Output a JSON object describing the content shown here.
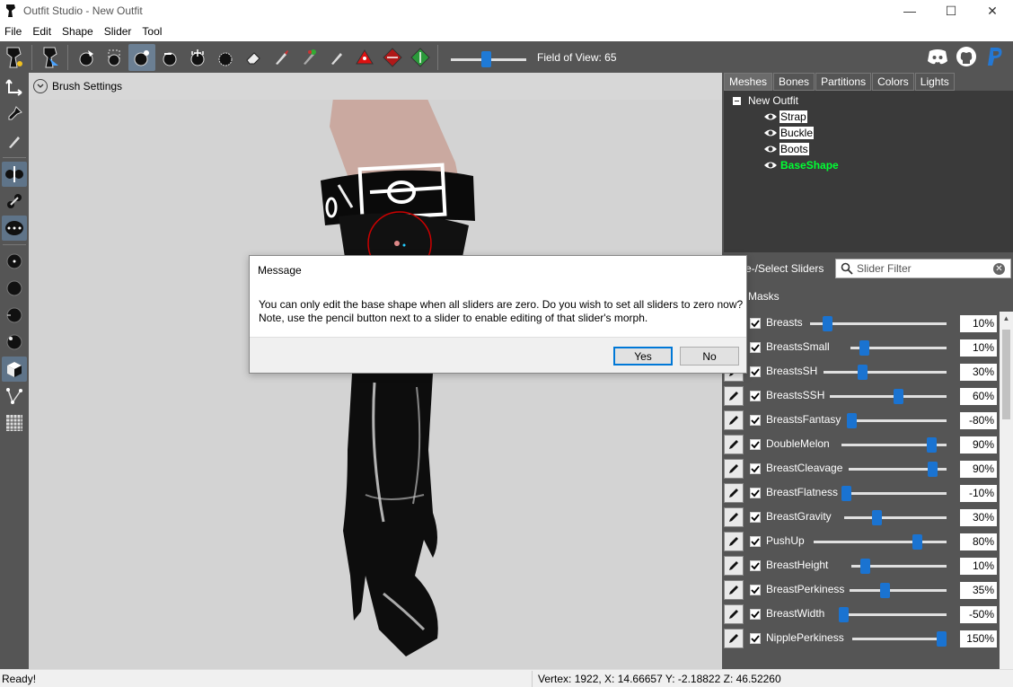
{
  "window": {
    "title": "Outfit Studio - New Outfit",
    "minimize": "—",
    "maximize": "☐",
    "close": "✕"
  },
  "menu": [
    "File",
    "Edit",
    "Shape",
    "Slider",
    "Tool"
  ],
  "toolbar": {
    "icons": [
      "logo-icon",
      "brush-select-icon",
      "mask-brush-icon",
      "inflate-brush-icon",
      "deflate-brush-icon",
      "move-brush-icon",
      "smooth-brush-icon",
      "undiff-brush-icon",
      "eraser-icon",
      "color-brush-icon",
      "alpha-brush-icon",
      "weight-brush-icon",
      "collapse-vertex-icon",
      "flip-edge-icon",
      "split-edge-icon"
    ],
    "fov_label": "Field of View: 65",
    "fov_value": 65,
    "right_icons": [
      "discord-icon",
      "github-icon",
      "paypal-icon"
    ]
  },
  "viewport": {
    "brush_settings_label": "Brush Settings"
  },
  "right": {
    "tabs": [
      "Meshes",
      "Bones",
      "Partitions",
      "Colors",
      "Lights"
    ],
    "active_tab": "Meshes",
    "tree_root": "New Outfit",
    "meshes": [
      "Strap",
      "Buckle",
      "Boots",
      "BaseShape"
    ],
    "slider_section_label": "e-/Select Sliders",
    "slider_filter_placeholder": "Slider Filter",
    "masks_label": "Masks",
    "sliders": [
      {
        "name": "Breasts",
        "value": "10%",
        "pos": 0.1
      },
      {
        "name": "BreastsSmall",
        "value": "10%",
        "pos": 0.1
      },
      {
        "name": "BreastsSH",
        "value": "30%",
        "pos": 0.3
      },
      {
        "name": "BreastsSSH",
        "value": "60%",
        "pos": 0.6
      },
      {
        "name": "BreastsFantasy",
        "value": "-80%",
        "pos": 0.0
      },
      {
        "name": "DoubleMelon",
        "value": "90%",
        "pos": 0.9
      },
      {
        "name": "BreastCleavage",
        "value": "90%",
        "pos": 0.9
      },
      {
        "name": "BreastFlatness",
        "value": "-10%",
        "pos": 0.0
      },
      {
        "name": "BreastGravity",
        "value": "30%",
        "pos": 0.3
      },
      {
        "name": "PushUp",
        "value": "80%",
        "pos": 0.8
      },
      {
        "name": "BreastHeight",
        "value": "10%",
        "pos": 0.1
      },
      {
        "name": "BreastPerkiness",
        "value": "35%",
        "pos": 0.35
      },
      {
        "name": "BreastWidth",
        "value": "-50%",
        "pos": 0.0
      },
      {
        "name": "NipplePerkiness",
        "value": "150%",
        "pos": 1.0
      }
    ]
  },
  "dialog": {
    "title": "Message",
    "line1": "You can only edit the base shape when all sliders are zero. Do you wish to set all sliders to zero now?",
    "line2": "Note, use the pencil button next to a slider to enable editing of that slider's morph.",
    "yes": "Yes",
    "no": "No"
  },
  "status": {
    "left": "Ready!",
    "right": "Vertex: 1922, X: 14.66657 Y: -2.18822 Z: 46.52260"
  },
  "colors": {
    "accent": "#1a73d1",
    "panel": "#555555",
    "base_shape": "#00ff33"
  }
}
